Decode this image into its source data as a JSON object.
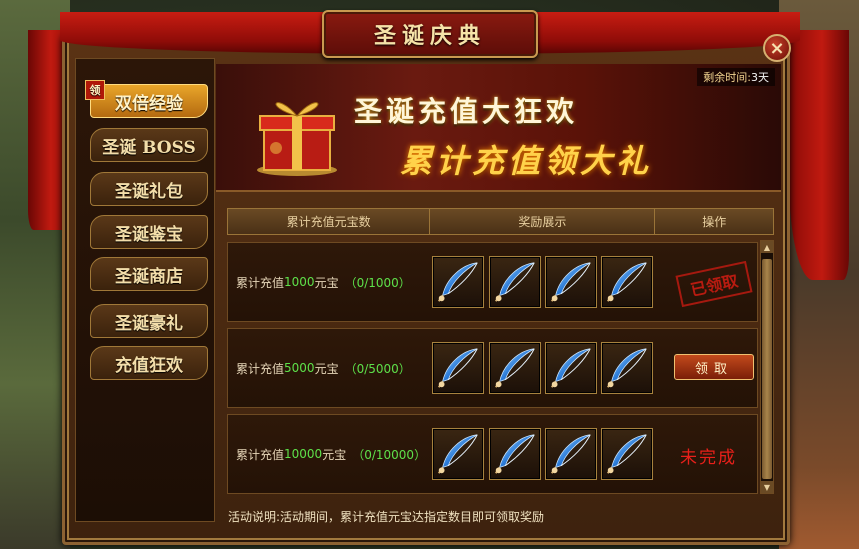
{
  "window": {
    "title": "圣诞庆典",
    "close_icon": "×"
  },
  "sidebar": {
    "badge": "领",
    "items": [
      {
        "label": "双倍经验"
      },
      {
        "label": "圣诞 BOSS"
      },
      {
        "label": "圣诞礼包"
      },
      {
        "label": "圣诞鉴宝"
      },
      {
        "label": "圣诞商店"
      },
      {
        "label": "圣诞豪礼"
      },
      {
        "label": "充值狂欢"
      }
    ]
  },
  "banner": {
    "countdown_label": "剩余时间:",
    "countdown_value": "3天",
    "headline1": "圣诞充值大狂欢",
    "headline2": "累计充值领大礼"
  },
  "table": {
    "headers": [
      "累计充值元宝数",
      "奖励展示",
      "操作"
    ],
    "rows": [
      {
        "prefix": "累计充值",
        "amount": "1000",
        "suffix": "元宝",
        "progress": "（0/1000）",
        "status": "已领取"
      },
      {
        "prefix": "累计充值",
        "amount": "5000",
        "suffix": "元宝",
        "progress": "（0/5000）",
        "button": "领取"
      },
      {
        "prefix": "累计充值",
        "amount": "10000",
        "suffix": "元宝",
        "progress": "（0/10000）",
        "status": "未完成"
      }
    ]
  },
  "footer": {
    "note": "活动说明:活动期间，累计充值元宝达指定数目即可领取奖励"
  },
  "colors": {
    "accent_gold": "#ffd24a",
    "progress_green": "#5ee04a",
    "incomplete_red": "#e8201a"
  }
}
